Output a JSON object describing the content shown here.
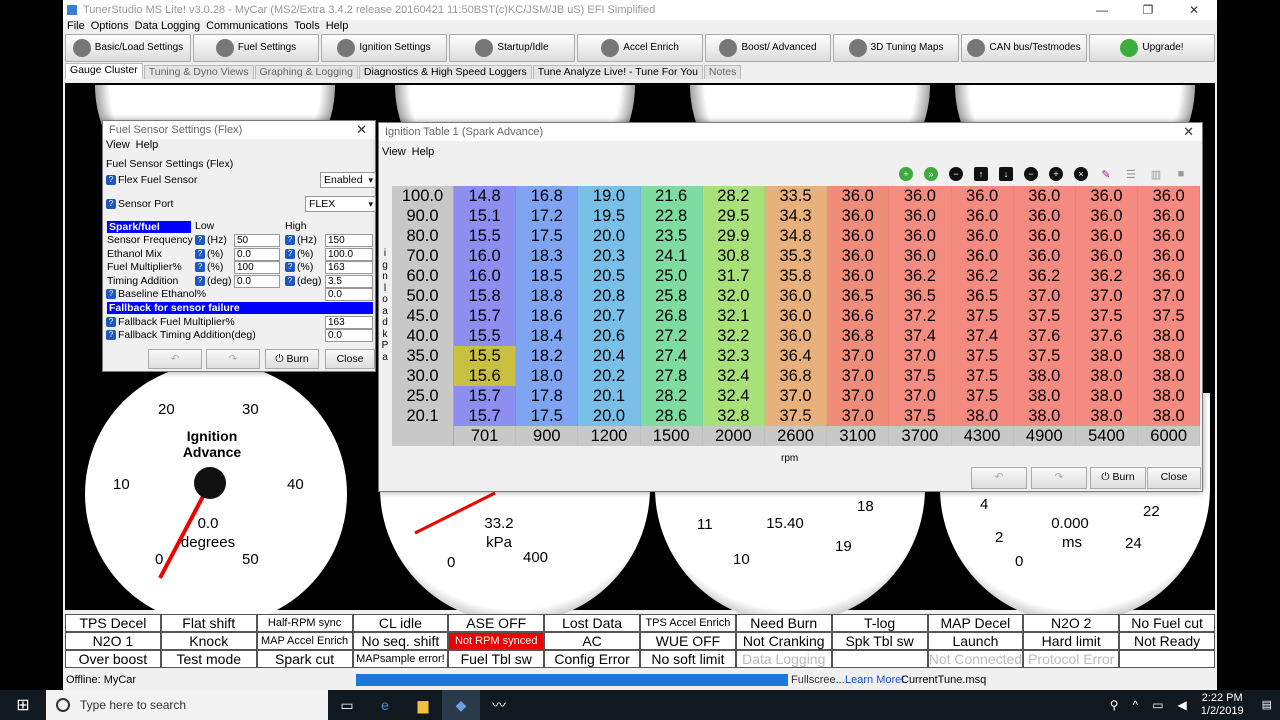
{
  "window": {
    "title": "TunerStudio MS Lite! v3.0.28 - MyCar (MS2/Extra 3.4.2 release  20160421 11:50BST(c)KC/JSM/JB    uS) EFI Simplified",
    "controls": [
      "—",
      "❐",
      "✕"
    ]
  },
  "menu": [
    "File",
    "Options",
    "Data Logging",
    "Communications",
    "Tools",
    "Help"
  ],
  "toolbar": [
    {
      "label": "Basic/Load Settings",
      "icon": "gears-icon"
    },
    {
      "label": "Fuel Settings",
      "icon": "injector-icon"
    },
    {
      "label": "Ignition Settings",
      "icon": "spark-plug-icon"
    },
    {
      "label": "Startup/Idle",
      "icon": "wrench-icon"
    },
    {
      "label": "Accel Enrich",
      "icon": "wrench-icon"
    },
    {
      "label": "Boost/ Advanced",
      "icon": "turbo-icon"
    },
    {
      "label": "3D Tuning Maps",
      "icon": "3d-map-icon"
    },
    {
      "label": "CAN bus/Testmodes",
      "icon": "hammer-icon"
    },
    {
      "label": "Upgrade!",
      "icon": "upgrade-icon"
    }
  ],
  "tabs": [
    "Gauge Cluster",
    "Tuning & Dyno Views",
    "Graphing & Logging",
    "Diagnostics & High Speed Loggers",
    "Tune Analyze Live! - Tune For You",
    "Notes"
  ],
  "gauges": {
    "ignition": {
      "title": "Ignition Advance",
      "value": "0.0",
      "unit": "degrees",
      "ticks": [
        "0",
        "10",
        "20",
        "30",
        "40",
        "50"
      ]
    },
    "map": {
      "value": "33.2",
      "unit": "kPa",
      "ticks": [
        "0",
        "400"
      ]
    },
    "volts": {
      "value": "15.40",
      "ticks": [
        "10",
        "11",
        "18",
        "19"
      ]
    },
    "pw": {
      "value": "0.000",
      "unit": "ms",
      "ticks": [
        "0",
        "2",
        "4",
        "22",
        "24"
      ]
    }
  },
  "indicators": [
    [
      "TPS Decel",
      "Flat shift",
      "Half-RPM sync",
      "CL idle",
      "ASE OFF",
      "Lost Data",
      "TPS Accel Enrich",
      "Need Burn",
      "T-log",
      "MAP Decel",
      "N2O 2",
      "No Fuel cut"
    ],
    [
      "N2O 1",
      "Knock",
      "MAP Accel Enrich",
      "No seq. shift",
      "Not RPM synced",
      "AC",
      "WUE OFF",
      "Not Cranking",
      "Spk Tbl sw",
      "Launch",
      "Hard limit",
      "Not Ready"
    ],
    [
      "Over boost",
      "Test mode",
      "Spark cut",
      "MAPsample error!",
      "Fuel Tbl sw",
      "Config Error",
      "No soft limit",
      "Data Logging",
      "",
      "Not Connected",
      "Protocol Error",
      ""
    ]
  ],
  "status": {
    "left": "Offline: MyCar",
    "fullscreen": "Fullscree...",
    "learn": "Learn More!",
    "tune": "CurrentTune.msq"
  },
  "taskbar": {
    "search": "Type here to search",
    "time": "2:22 PM",
    "date": "1/2/2019"
  },
  "flex": {
    "title": "Fuel Sensor Settings (Flex)",
    "menu": [
      "View",
      "Help"
    ],
    "section": "Fuel Sensor Settings (Flex)",
    "flex_label": "Flex Fuel Sensor",
    "flex_value": "Enabled",
    "port_label": "Sensor Port",
    "port_value": "FLEX",
    "spark_hdr": "Spark/fuel",
    "low": "Low",
    "high": "High",
    "rows": [
      {
        "label": "Sensor Frequency",
        "unit": "(Hz)",
        "low": "50",
        "high": "150"
      },
      {
        "label": "Ethanol Mix",
        "unit": "(%)",
        "low": "0.0",
        "high": "100.0"
      },
      {
        "label": "Fuel Multiplier%",
        "unit": "(%)",
        "low": "100",
        "high": "163"
      },
      {
        "label": "Timing Addition",
        "unit": "(deg)",
        "low": "0.0",
        "high": "3.5"
      }
    ],
    "baseline_label": "Baseline Ethanol%",
    "baseline_value": "0.0",
    "fallback_hdr": "Fallback for sensor failure",
    "fb_fuel_label": "Fallback Fuel Multiplier%",
    "fb_fuel_value": "163",
    "fb_timing_label": "Fallback Timing Addition(deg)",
    "fb_timing_value": "0.0",
    "burn": "Burn",
    "close": "Close"
  },
  "ign": {
    "title": "Ignition Table 1 (Spark Advance)",
    "menu": [
      "View",
      "Help"
    ],
    "yaxis": "i g n l o a d k P a",
    "xaxis": "rpm",
    "loads": [
      "100.0",
      "90.0",
      "80.0",
      "70.0",
      "60.0",
      "50.0",
      "45.0",
      "40.0",
      "35.0",
      "30.0",
      "25.0",
      "20.1"
    ],
    "rpms": [
      "701",
      "900",
      "1200",
      "1500",
      "2000",
      "2600",
      "3100",
      "3700",
      "4300",
      "4900",
      "5400",
      "6000"
    ],
    "values": [
      [
        "14.8",
        "16.8",
        "19.0",
        "21.6",
        "28.2",
        "33.5",
        "36.0",
        "36.0",
        "36.0",
        "36.0",
        "36.0",
        "36.0"
      ],
      [
        "15.1",
        "17.2",
        "19.5",
        "22.8",
        "29.5",
        "34.3",
        "36.0",
        "36.0",
        "36.0",
        "36.0",
        "36.0",
        "36.0"
      ],
      [
        "15.5",
        "17.5",
        "20.0",
        "23.5",
        "29.9",
        "34.8",
        "36.0",
        "36.0",
        "36.0",
        "36.0",
        "36.0",
        "36.0"
      ],
      [
        "16.0",
        "18.3",
        "20.3",
        "24.1",
        "30.8",
        "35.3",
        "36.0",
        "36.0",
        "36.0",
        "36.0",
        "36.0",
        "36.0"
      ],
      [
        "16.0",
        "18.5",
        "20.5",
        "25.0",
        "31.7",
        "35.8",
        "36.0",
        "36.2",
        "36.2",
        "36.2",
        "36.2",
        "36.0"
      ],
      [
        "15.8",
        "18.8",
        "20.8",
        "25.8",
        "32.0",
        "36.0",
        "36.5",
        "36.5",
        "36.5",
        "37.0",
        "37.0",
        "37.0"
      ],
      [
        "15.7",
        "18.6",
        "20.7",
        "26.8",
        "32.1",
        "36.0",
        "36.6",
        "37.2",
        "37.5",
        "37.5",
        "37.5",
        "37.5"
      ],
      [
        "15.5",
        "18.4",
        "20.6",
        "27.2",
        "32.2",
        "36.0",
        "36.8",
        "37.4",
        "37.4",
        "37.6",
        "37.6",
        "38.0"
      ],
      [
        "15.5",
        "18.2",
        "20.4",
        "27.4",
        "32.3",
        "36.4",
        "37.0",
        "37.0",
        "37.5",
        "37.5",
        "38.0",
        "38.0"
      ],
      [
        "15.6",
        "18.0",
        "20.2",
        "27.8",
        "32.4",
        "36.8",
        "37.0",
        "37.5",
        "37.5",
        "38.0",
        "38.0",
        "38.0"
      ],
      [
        "15.7",
        "17.8",
        "20.1",
        "28.2",
        "32.4",
        "37.0",
        "37.0",
        "37.0",
        "37.5",
        "38.0",
        "38.0",
        "38.0"
      ],
      [
        "15.7",
        "17.5",
        "20.0",
        "28.6",
        "32.8",
        "37.5",
        "37.0",
        "37.5",
        "38.0",
        "38.0",
        "38.0",
        "38.0"
      ]
    ],
    "col_colors": [
      "#8c8ef0",
      "#7ea4f2",
      "#79c0e8",
      "#7fdca0",
      "#a8e07a",
      "#e8b07a",
      "#f08c7a",
      "#f48c80",
      "#f48a80",
      "#f48a80",
      "#f48a80",
      "#f48a80"
    ],
    "burn": "Burn",
    "close": "Close"
  }
}
